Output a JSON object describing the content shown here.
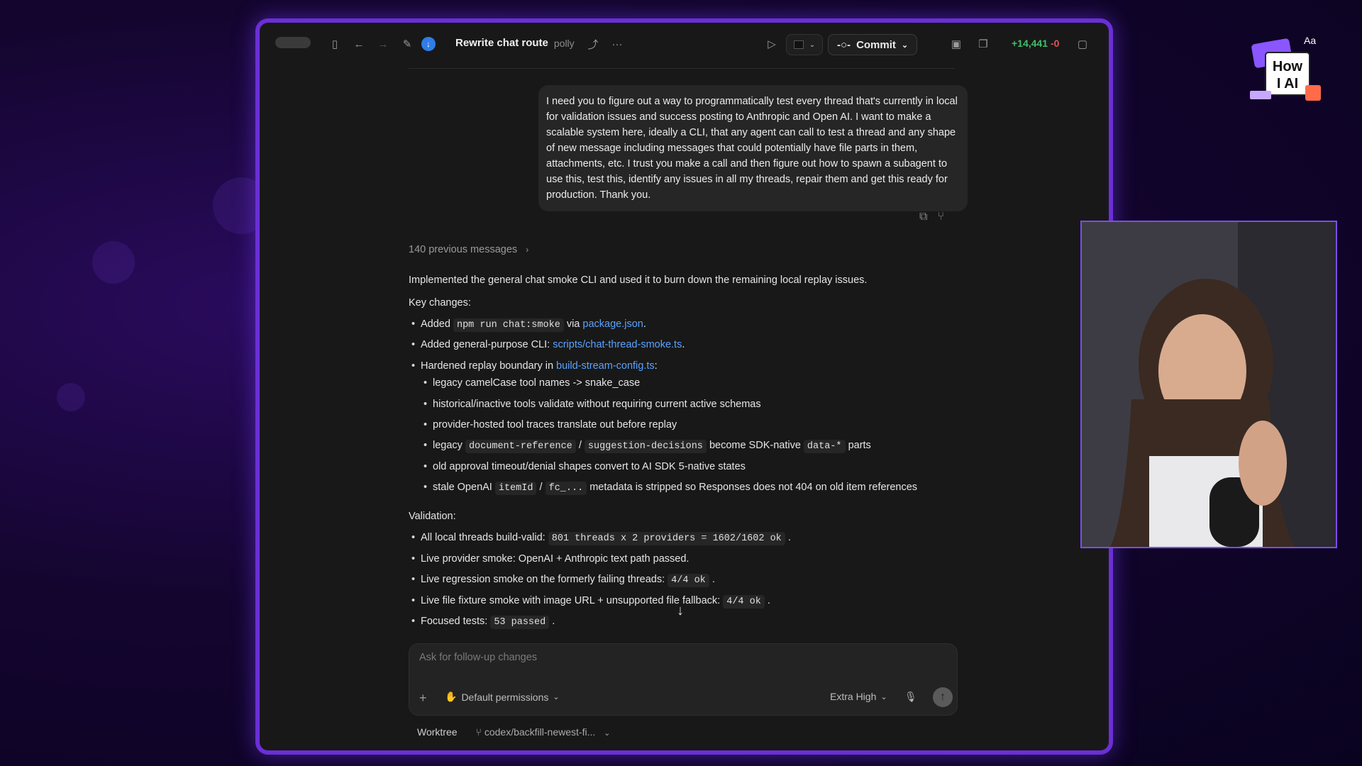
{
  "toolbar": {
    "title": "Rewrite chat route",
    "subtitle": "polly",
    "commit_label": "Commit",
    "additions": "+14,441",
    "deletions": "-0",
    "icons": [
      "sidebar-toggle-icon",
      "back-arrow-icon",
      "forward-arrow-icon",
      "compose-icon",
      "download-icon",
      "share-icon",
      "more-icon",
      "play-icon",
      "terminal-icon",
      "commit-icon",
      "panel-icon",
      "copy-window-icon",
      "layout-icon"
    ]
  },
  "user_message": "I need you to figure out a way to programmatically test every thread that's currently in local for validation issues and success posting to Anthropic and Open AI. I want to make a scalable system here, ideally a CLI, that any agent can call to test a thread and any shape of new message including messages that could potentially have file parts in them, attachments, etc. I trust you make a call and then figure out how to spawn a subagent to use this, test this, identify any issues in all my threads, repair them and get this ready for production. Thank you.",
  "previous_messages": "140 previous messages",
  "response": {
    "summary": "Implemented the general chat smoke CLI and used it to burn down the remaining local replay issues.",
    "key_changes_heading": "Key changes:",
    "kc1": {
      "pre": "Added",
      "code": "npm run chat:smoke",
      "mid": "via",
      "link": "package.json",
      "post": "."
    },
    "kc2": {
      "pre": "Added general-purpose CLI:",
      "link": "scripts/chat-thread-smoke.ts",
      "post": "."
    },
    "kc3": {
      "pre": "Hardened replay boundary in",
      "link": "build-stream-config.ts",
      "post": ":"
    },
    "sub1": "legacy camelCase tool names -> snake_case",
    "sub2": "historical/inactive tools validate without requiring current active schemas",
    "sub3": "provider-hosted tool traces translate out before replay",
    "sub4": {
      "pre": "legacy",
      "code1": "document-reference",
      "sep": "/",
      "code2": "suggestion-decisions",
      "mid": "become SDK-native",
      "code3": "data-*",
      "post": "parts"
    },
    "sub5": "old approval timeout/denial shapes convert to AI SDK 5-native states",
    "sub6": {
      "pre": "stale OpenAI",
      "code1": "itemId",
      "sep": "/",
      "code2": "fc_...",
      "post": "metadata is stripped so Responses does not 404 on old item references"
    },
    "validation_heading": "Validation:",
    "v1": {
      "pre": "All local threads build-valid:",
      "code": "801 threads x 2 providers = 1602/1602 ok",
      "post": "."
    },
    "v2": "Live provider smoke: OpenAI + Anthropic text path passed.",
    "v3": {
      "pre": "Live regression smoke on the formerly failing threads:",
      "code": "4/4 ok",
      "post": "."
    },
    "v4": {
      "pre": "Live file fixture smoke with image URL + unsupported file fallback:",
      "code": "4/4 ok",
      "post": "."
    },
    "v5": {
      "pre": "Focused tests:",
      "code": "53 passed",
      "post": "."
    }
  },
  "composer": {
    "placeholder": "Ask for follow-up changes",
    "permissions": "Default permissions",
    "effort": "Extra High"
  },
  "footer": {
    "worktree": "Worktree",
    "branch": "codex/backfill-newest-fi..."
  },
  "logo": {
    "line1": "How",
    "line2": "I AI",
    "corner": "Aa"
  },
  "colors": {
    "accent": "#6a2fd6",
    "link": "#5aa3ff",
    "additions": "#3fbf6a",
    "deletions": "#e05252"
  }
}
